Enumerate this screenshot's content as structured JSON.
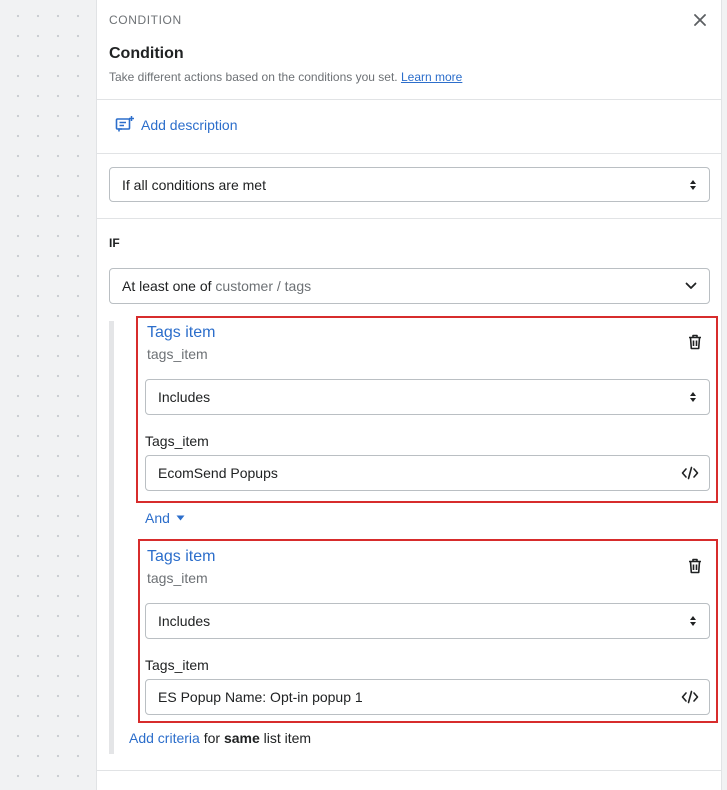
{
  "header": {
    "label": "CONDITION",
    "title": "Condition",
    "subtitle": "Take different actions based on the conditions you set.",
    "learn_more": "Learn more"
  },
  "description": {
    "label": "Add description"
  },
  "condition_mode": {
    "value": "If all conditions are met"
  },
  "if_label": "IF",
  "criteria": {
    "prefix": "At least one of",
    "path": "customer / tags"
  },
  "items": [
    {
      "title": "Tags item",
      "subtitle": "tags_item",
      "operator": "Includes",
      "field_label": "Tags_item",
      "value": "EcomSend Popups"
    },
    {
      "title": "Tags item",
      "subtitle": "tags_item",
      "operator": "Includes",
      "field_label": "Tags_item",
      "value": "ES Popup Name: Opt-in popup 1"
    }
  ],
  "and_label": "And",
  "add_criteria": {
    "link": "Add criteria",
    "text1": "for",
    "bold": "same",
    "text2": "list item"
  },
  "colors": {
    "accent": "#2c6ecb",
    "highlight": "#d72c2c"
  }
}
